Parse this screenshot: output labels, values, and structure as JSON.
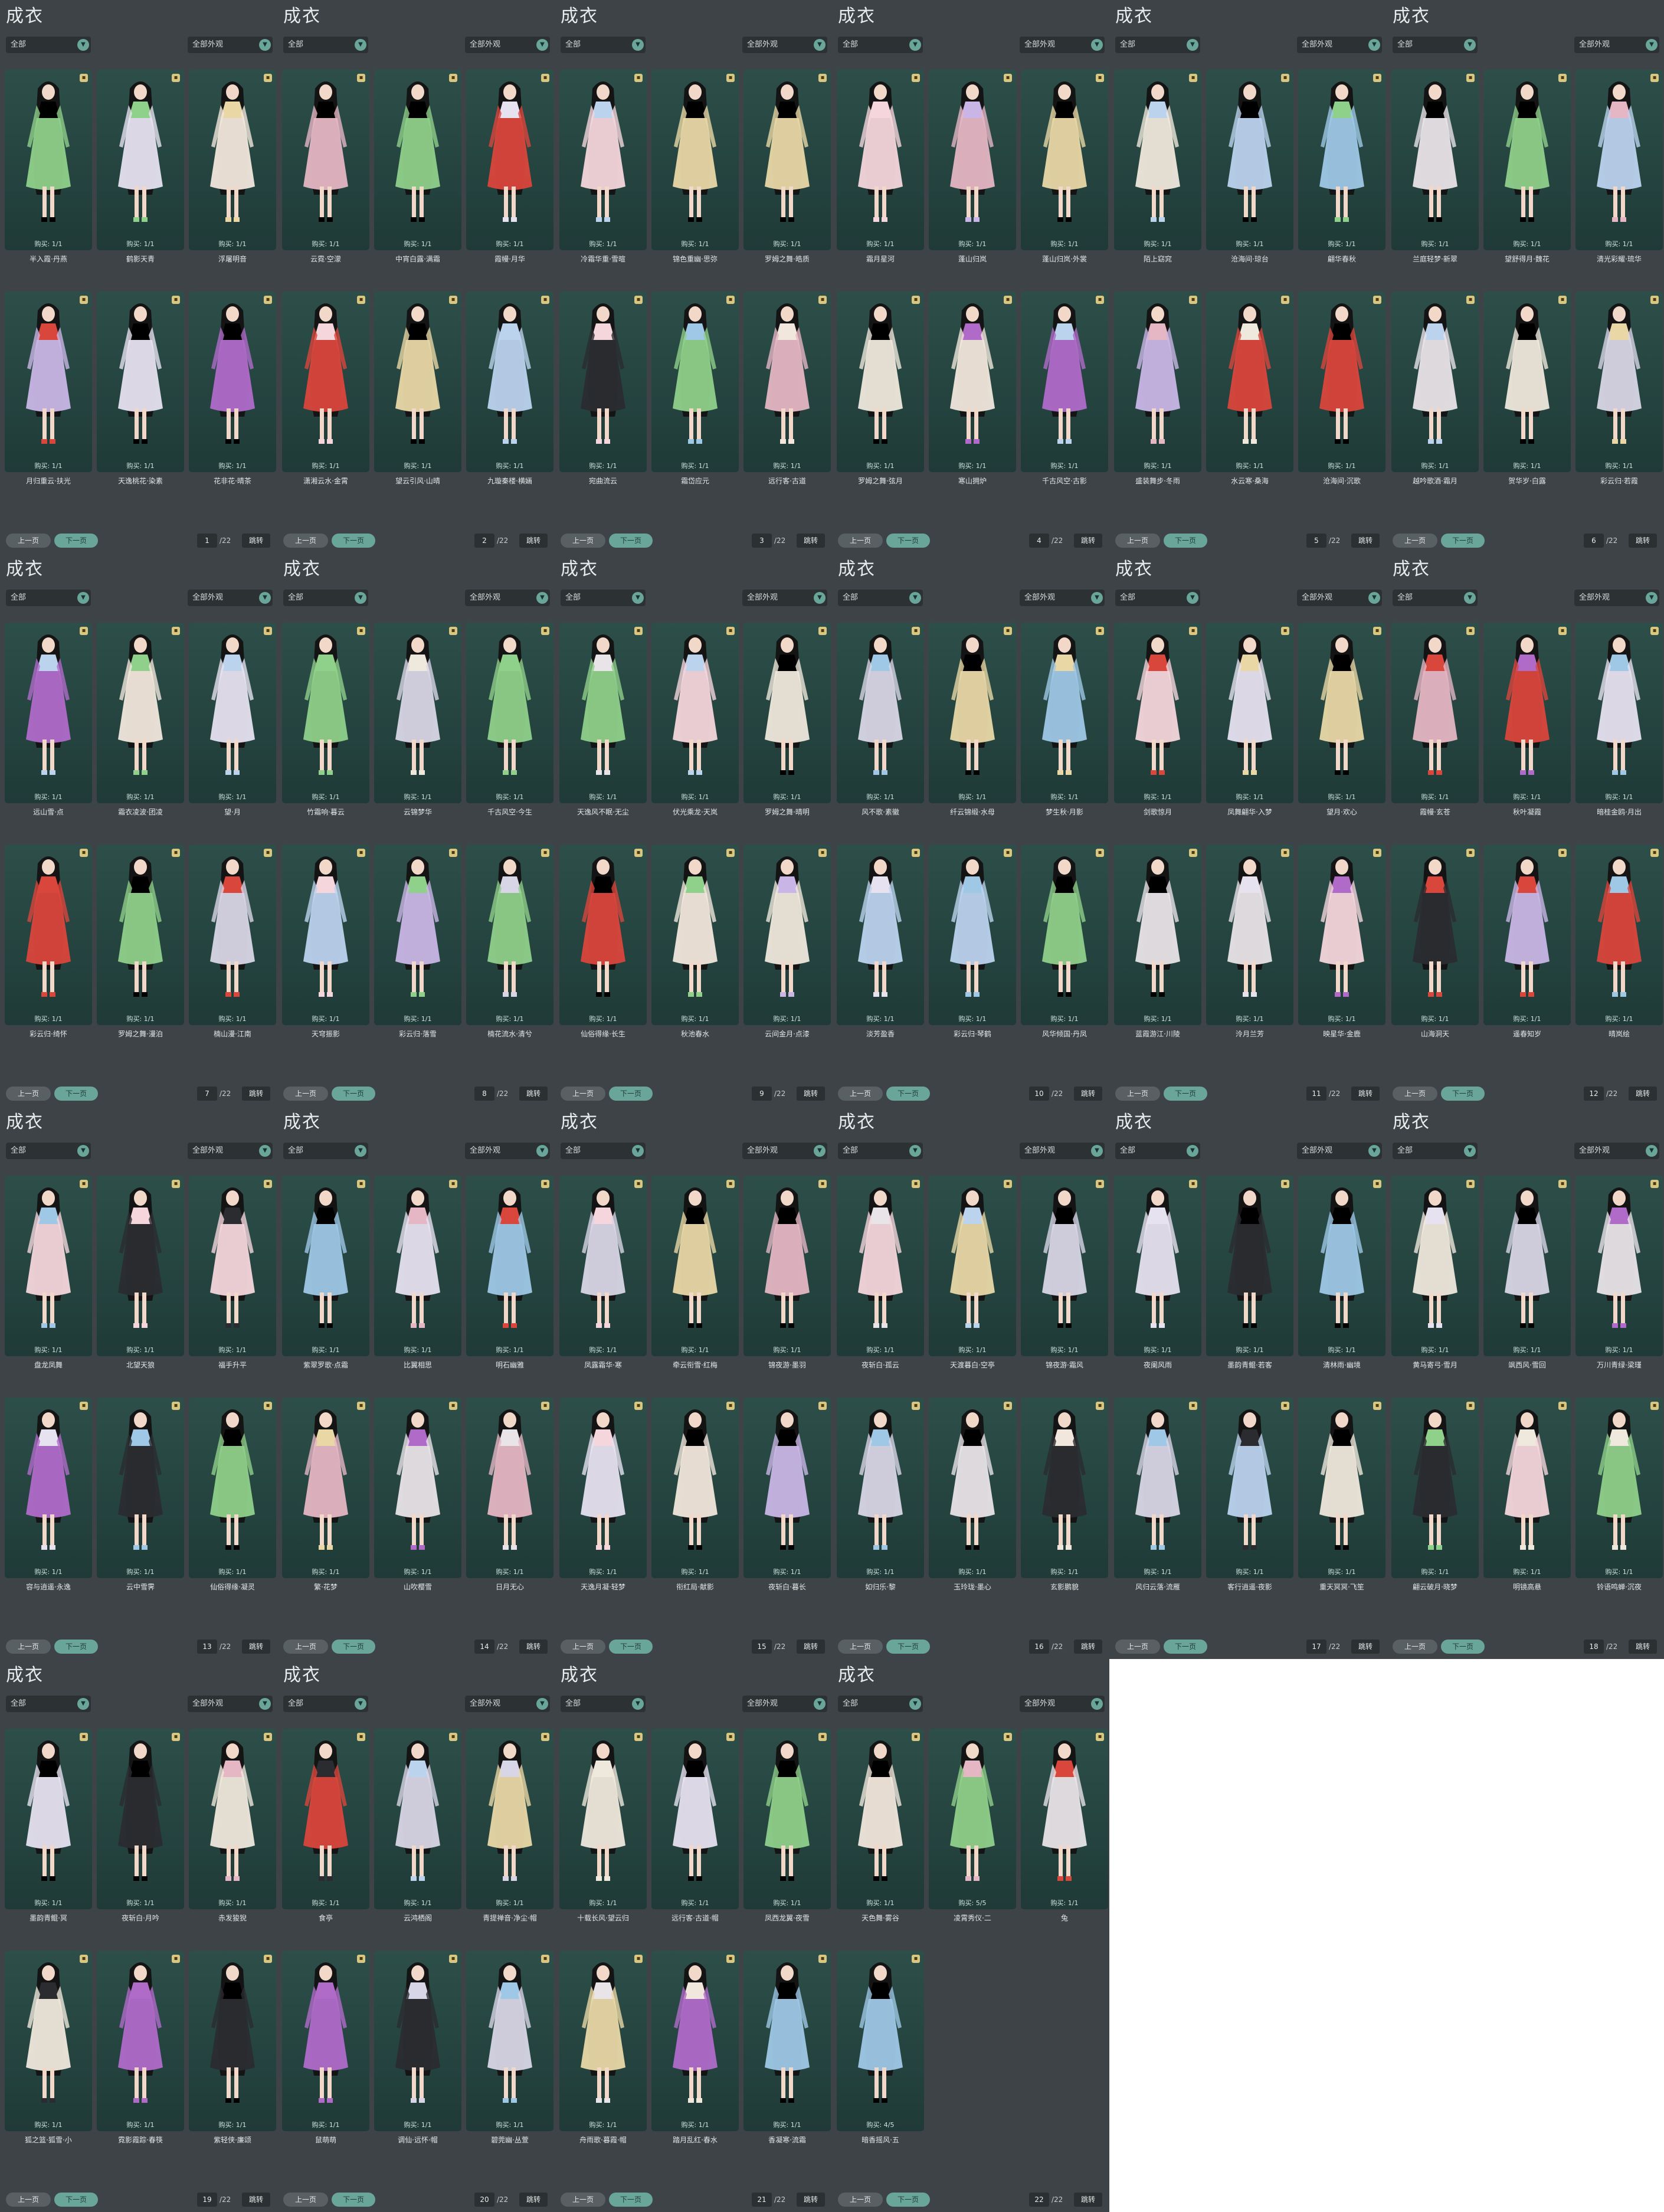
{
  "title": "成衣",
  "filter_left": "全部",
  "filter_right": "全部外观",
  "prev_label": "上一页",
  "next_label": "下一页",
  "jump_label": "跳转",
  "total_pages": "/22",
  "pages": [
    {
      "page": "1",
      "items": [
        {
          "name": "半入霞·丹燕",
          "buy": "购买: 1/1"
        },
        {
          "name": "鹤影天青",
          "buy": "购买: 1/1"
        },
        {
          "name": "浮屠明音",
          "buy": "购买: 1/1"
        },
        {
          "name": "月归重云·扶光",
          "buy": "购买: 1/1"
        },
        {
          "name": "天逸桃花·染素",
          "buy": "购买: 1/1"
        },
        {
          "name": "花非花·晴茶",
          "buy": "购买: 1/1"
        }
      ]
    },
    {
      "page": "2",
      "items": [
        {
          "name": "云霓·空濛",
          "buy": "购买: 1/1"
        },
        {
          "name": "中宵白露·满霜",
          "buy": "购买: 1/1"
        },
        {
          "name": "霞幔·月华",
          "buy": "购买: 1/1"
        },
        {
          "name": "潇湘云水·金霄",
          "buy": "购买: 1/1"
        },
        {
          "name": "望云引风·山晴",
          "buy": "购买: 1/1"
        },
        {
          "name": "九璇秦楼·横婳",
          "buy": "购买: 1/1"
        }
      ]
    },
    {
      "page": "3",
      "items": [
        {
          "name": "冷霜华重·雪暄",
          "buy": "购买: 1/1"
        },
        {
          "name": "锦色重幽·思弥",
          "buy": "购买: 1/1"
        },
        {
          "name": "罗姆之舞·皓质",
          "buy": "购买: 1/1"
        },
        {
          "name": "宛曲流云",
          "buy": "购买: 1/1"
        },
        {
          "name": "霜岱应元",
          "buy": "购买: 1/1"
        },
        {
          "name": "远行客·古道",
          "buy": "购买: 1/1"
        }
      ]
    },
    {
      "page": "4",
      "items": [
        {
          "name": "霜月星河",
          "buy": "购买: 1/1"
        },
        {
          "name": "蓬山归岚",
          "buy": "购买: 1/1"
        },
        {
          "name": "蓬山归岚·外裳",
          "buy": "购买: 1/1"
        },
        {
          "name": "罗姆之舞·弦月",
          "buy": "购买: 1/1"
        },
        {
          "name": "寒山拥炉",
          "buy": "购买: 1/1"
        },
        {
          "name": "千古风空·古影",
          "buy": "购买: 1/1"
        }
      ]
    },
    {
      "page": "5",
      "items": [
        {
          "name": "陌上窈窕",
          "buy": "购买: 1/1"
        },
        {
          "name": "沧海间·琼台",
          "buy": "购买: 1/1"
        },
        {
          "name": "翩华春秋",
          "buy": "购买: 1/1"
        },
        {
          "name": "盛装舞步·冬雨",
          "buy": "购买: 1/1"
        },
        {
          "name": "水云寒·桑海",
          "buy": "购买: 1/1"
        },
        {
          "name": "沧海间·沉歌",
          "buy": "购买: 1/1"
        }
      ]
    },
    {
      "page": "6",
      "items": [
        {
          "name": "兰庭轻梦·新翠",
          "buy": "购买: 1/1"
        },
        {
          "name": "望舒得月·魏花",
          "buy": "购买: 1/1"
        },
        {
          "name": "清光彩耀·琉华",
          "buy": "购买: 1/1"
        },
        {
          "name": "越吟歌酒·霜月",
          "buy": "购买: 1/1"
        },
        {
          "name": "贺华岁·白露",
          "buy": "购买: 1/1"
        },
        {
          "name": "彩云归·若霞",
          "buy": "购买: 1/1"
        }
      ]
    },
    {
      "page": "7",
      "items": [
        {
          "name": "远山雪·点",
          "buy": "购买: 1/1"
        },
        {
          "name": "霜衣凌波·团凌",
          "buy": "购买: 1/1"
        },
        {
          "name": "望·月",
          "buy": "购买: 1/1"
        },
        {
          "name": "彩云归·绮怀",
          "buy": "购买: 1/1"
        },
        {
          "name": "罗姆之舞·漫泊",
          "buy": "购买: 1/1"
        },
        {
          "name": "楠山漫·江南",
          "buy": "购买: 1/1"
        }
      ]
    },
    {
      "page": "8",
      "items": [
        {
          "name": "竹霜响·暮云",
          "buy": "购买: 1/1"
        },
        {
          "name": "云锦梦华",
          "buy": "购买: 1/1"
        },
        {
          "name": "千古风空·今生",
          "buy": "购买: 1/1"
        },
        {
          "name": "天穹振影",
          "buy": "购买: 1/1"
        },
        {
          "name": "彩云归·落雪",
          "buy": "购买: 1/1"
        },
        {
          "name": "楠花流水·清兮",
          "buy": "购买: 1/1"
        }
      ]
    },
    {
      "page": "9",
      "items": [
        {
          "name": "天逸风不眠·无尘",
          "buy": "购买: 1/1"
        },
        {
          "name": "伏光乘龙·天岚",
          "buy": "购买: 1/1"
        },
        {
          "name": "罗姆之舞·晴明",
          "buy": "购买: 1/1"
        },
        {
          "name": "仙俗得缘·长生",
          "buy": "购买: 1/1"
        },
        {
          "name": "秋池春水",
          "buy": "购买: 1/1"
        },
        {
          "name": "云间金月·点漆",
          "buy": "购买: 1/1"
        }
      ]
    },
    {
      "page": "10",
      "items": [
        {
          "name": "风不歌·素徽",
          "buy": "购买: 1/1"
        },
        {
          "name": "纤云锦缎·水母",
          "buy": "购买: 1/1"
        },
        {
          "name": "梦生秋·月影",
          "buy": "购买: 1/1"
        },
        {
          "name": "淡芳盈香",
          "buy": "购买: 1/1"
        },
        {
          "name": "彩云归·琴鹤",
          "buy": "购买: 1/1"
        },
        {
          "name": "风华倾国·丹凤",
          "buy": "购买: 1/1"
        }
      ]
    },
    {
      "page": "11",
      "items": [
        {
          "name": "剑歌惊月",
          "buy": "购买: 1/1"
        },
        {
          "name": "凤舞翩华·入梦",
          "buy": "购买: 1/1"
        },
        {
          "name": "望月·欢心",
          "buy": "购买: 1/1"
        },
        {
          "name": "蓝霞游江·川陵",
          "buy": "购买: 1/1"
        },
        {
          "name": "泠月兰芳",
          "buy": "购买: 1/1"
        },
        {
          "name": "映星华·金鹿",
          "buy": "购买: 1/1"
        }
      ]
    },
    {
      "page": "12",
      "items": [
        {
          "name": "霞幔·玄苍",
          "buy": "购买: 1/1"
        },
        {
          "name": "秋叶凝霞",
          "buy": "购买: 1/1"
        },
        {
          "name": "暗桂金鸥·月出",
          "buy": "购买: 1/1"
        },
        {
          "name": "山海洞天",
          "buy": "购买: 1/1"
        },
        {
          "name": "遥春知岁",
          "buy": "购买: 1/1"
        },
        {
          "name": "晴岚绘",
          "buy": "购买: 1/1"
        }
      ]
    },
    {
      "page": "13",
      "items": [
        {
          "name": "盘龙凤舞",
          "buy": "购买: 1/1"
        },
        {
          "name": "北望天狼",
          "buy": "购买: 1/1"
        },
        {
          "name": "福手升平",
          "buy": "购买: 1/1"
        },
        {
          "name": "容与逍遥·永逸",
          "buy": "购买: 1/1"
        },
        {
          "name": "云中雪霁",
          "buy": "购买: 1/1"
        },
        {
          "name": "仙俗得缘·凝灵",
          "buy": "购买: 1/1"
        }
      ]
    },
    {
      "page": "14",
      "items": [
        {
          "name": "紫翠罗歌·点霜",
          "buy": "购买: 1/1"
        },
        {
          "name": "比翼相思",
          "buy": "购买: 1/1"
        },
        {
          "name": "明石幽雅",
          "buy": "购买: 1/1"
        },
        {
          "name": "繁·花梦",
          "buy": "购买: 1/1"
        },
        {
          "name": "山吹樱雪",
          "buy": "购买: 1/1"
        },
        {
          "name": "日月无心",
          "buy": "购买: 1/1"
        }
      ]
    },
    {
      "page": "15",
      "items": [
        {
          "name": "凤露霜华·寒",
          "buy": "购买: 1/1"
        },
        {
          "name": "牵云衔雪·红梅",
          "buy": "购买: 1/1"
        },
        {
          "name": "锦夜游·墨羽",
          "buy": "购买: 1/1"
        },
        {
          "name": "天逸月凝·轻梦",
          "buy": "购买: 1/1"
        },
        {
          "name": "衔红局·献影",
          "buy": "购买: 1/1"
        },
        {
          "name": "夜斩白·暮长",
          "buy": "购买: 1/1"
        }
      ]
    },
    {
      "page": "16",
      "items": [
        {
          "name": "夜斩白·孤云",
          "buy": "购买: 1/1"
        },
        {
          "name": "天渡暮白·空亭",
          "buy": "购买: 1/1"
        },
        {
          "name": "锦夜游·霜风",
          "buy": "购买: 1/1"
        },
        {
          "name": "如归乐·黎",
          "buy": "购买: 1/1"
        },
        {
          "name": "玉玲珑·墨心",
          "buy": "购买: 1/1"
        },
        {
          "name": "玄影鹏貌",
          "buy": "购买: 1/1"
        }
      ]
    },
    {
      "page": "17",
      "items": [
        {
          "name": "夜阑风雨",
          "buy": "购买: 1/1"
        },
        {
          "name": "墨韵青鲲·若客",
          "buy": "购买: 1/1"
        },
        {
          "name": "清林雨·幽境",
          "buy": "购买: 1/1"
        },
        {
          "name": "风归云落·流雁",
          "buy": "购买: 1/1"
        },
        {
          "name": "客行逍遥·夜影",
          "buy": "购买: 1/1"
        },
        {
          "name": "重天冥冥·飞笙",
          "buy": "购买: 1/1"
        }
      ]
    },
    {
      "page": "18",
      "items": [
        {
          "name": "黄马寄弓·雪月",
          "buy": "购买: 1/1"
        },
        {
          "name": "飒西风·雪回",
          "buy": "购买: 1/1"
        },
        {
          "name": "万川青绿·梁瑾",
          "buy": "购买: 1/1"
        },
        {
          "name": "翩云破月·晓梦",
          "buy": "购买: 1/1"
        },
        {
          "name": "明镜高悬",
          "buy": "购买: 1/1"
        },
        {
          "name": "铃语鸣蝉·沉夜",
          "buy": "购买: 1/1"
        }
      ]
    },
    {
      "page": "19",
      "items": [
        {
          "name": "墨韵青鲲·冥",
          "buy": "购买: 1/1"
        },
        {
          "name": "夜斩白·月吟",
          "buy": "购买: 1/1"
        },
        {
          "name": "赤发狻猊",
          "buy": "购买: 1/1"
        },
        {
          "name": "狐之篮·狐雪·小",
          "buy": "购买: 1/1"
        },
        {
          "name": "霓影霞踪·春筷",
          "buy": "购买: 1/1"
        },
        {
          "name": "紫轻侠·廉颂",
          "buy": "购买: 1/1"
        }
      ]
    },
    {
      "page": "20",
      "items": [
        {
          "name": "食亭",
          "buy": "购买: 1/1"
        },
        {
          "name": "云鸿栖阁",
          "buy": "购买: 1/1"
        },
        {
          "name": "青提禅音·净尘·帽",
          "buy": "购买: 1/1"
        },
        {
          "name": "鼠萌萌",
          "buy": "购买: 1/1"
        },
        {
          "name": "调仙·远怀·帽",
          "buy": "购买: 1/1"
        },
        {
          "name": "碧莞幽·丛萱",
          "buy": "购买: 1/1"
        }
      ]
    },
    {
      "page": "21",
      "items": [
        {
          "name": "十载长风·望云归",
          "buy": "购买: 1/1"
        },
        {
          "name": "远行客·古道·帽",
          "buy": "购买: 1/1"
        },
        {
          "name": "凤西龙翼·夜雪",
          "buy": "购买: 1/1"
        },
        {
          "name": "舟雨歌·暮霞·帽",
          "buy": "购买: 1/1"
        },
        {
          "name": "踏月乱红·春水",
          "buy": "购买: 1/1"
        },
        {
          "name": "香凝寒·流霜",
          "buy": "购买: 1/1"
        }
      ]
    },
    {
      "page": "22",
      "items": [
        {
          "name": "天色舞·雾谷",
          "buy": "购买: 1/1"
        },
        {
          "name": "凌霄秀仪·二",
          "buy": "购买: 5/5"
        },
        {
          "name": "兔",
          "buy": "购买: 1/1"
        },
        {
          "name": "暗香摇风·五",
          "buy": "购买: 4/5"
        }
      ]
    }
  ],
  "colors": {
    "panel_bg": "#3e4347",
    "card_bg": "#2a4a46",
    "accent": "#6aa59a",
    "text": "#e3e7e7"
  }
}
